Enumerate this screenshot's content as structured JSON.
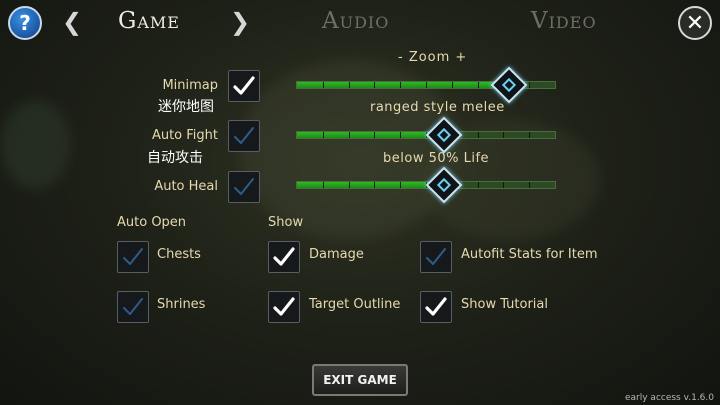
{
  "header": {
    "help_label": "?",
    "tabs": [
      {
        "label": "Game",
        "active": true
      },
      {
        "label": "Audio",
        "active": false
      },
      {
        "label": "Video",
        "active": false
      }
    ],
    "prev_arrow": "❮",
    "next_arrow": "❯",
    "close_label": "✕"
  },
  "zoom": {
    "label": "- Zoom +",
    "level": 0.82
  },
  "settings": {
    "minimap": {
      "label": "Minimap",
      "label_cn": "迷你地图",
      "checked": true
    },
    "auto_fight": {
      "label": "Auto Fight",
      "label_cn": "自动攻击",
      "checked": false,
      "caption": "ranged  style  melee",
      "level": 0.57
    },
    "auto_heal": {
      "label": "Auto Heal",
      "checked": false,
      "caption": "below 50% Life",
      "level": 0.57
    }
  },
  "auto_open": {
    "heading": "Auto Open",
    "chests": {
      "label": "Chests",
      "checked": false
    },
    "shrines": {
      "label": "Shrines",
      "checked": false
    }
  },
  "show": {
    "heading": "Show",
    "damage": {
      "label": "Damage",
      "checked": true
    },
    "target_outline": {
      "label": "Target Outline",
      "checked": true
    },
    "autofit_stats": {
      "label": "Autofit Stats for Item",
      "checked": false
    },
    "show_tutorial": {
      "label": "Show Tutorial",
      "checked": true
    }
  },
  "exit_button": "EXIT GAME",
  "version": "early access v.1.6.0",
  "colors": {
    "check_on": "#ffffff",
    "check_off": "#2f5c86",
    "slider_fill": "#2fb926",
    "knob_glow": "#6bd0f2"
  }
}
